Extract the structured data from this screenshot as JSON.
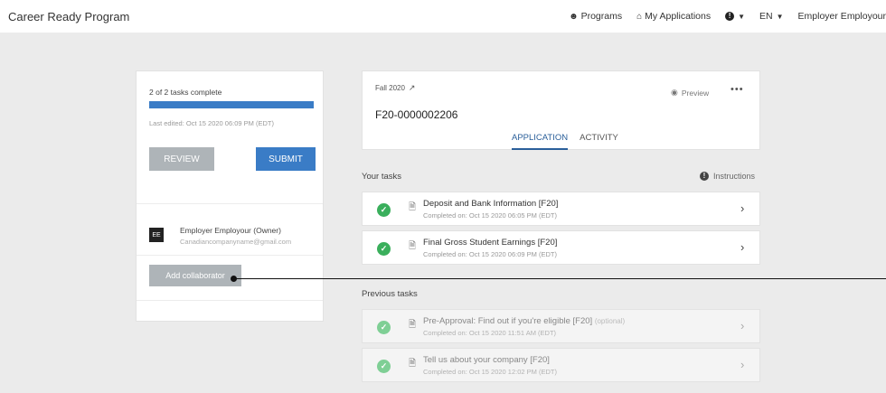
{
  "topbar": {
    "brand": "Career Ready Program",
    "nav": {
      "programs": "Programs",
      "my_applications": "My Applications",
      "language": "EN",
      "user": "Employer Employour"
    }
  },
  "summary": {
    "task_count": "2 of 2 tasks complete",
    "progress_fraction": 1.0,
    "last_edited": "Last edited: Oct 15 2020 06:09 PM (EDT)",
    "review_label": "REVIEW",
    "submit_label": "SUBMIT",
    "owner": {
      "initials": "EE",
      "name": "Employer Employour (Owner)",
      "email": "Canadiancompanyname@gmail.com"
    },
    "add_collaborator_label": "Add collaborator"
  },
  "application": {
    "term": "Fall 2020",
    "id": "F20-0000002206",
    "preview_label": "Preview",
    "more_label": "•••",
    "tabs": [
      {
        "label": "APPLICATION",
        "active": true
      },
      {
        "label": "ACTIVITY",
        "active": false
      }
    ]
  },
  "your_tasks": {
    "heading": "Your tasks",
    "instructions_label": "Instructions",
    "items": [
      {
        "title": "Deposit and Bank Information [F20]",
        "completed": "Completed on: Oct 15 2020 06:05 PM (EDT)"
      },
      {
        "title": "Final Gross Student Earnings [F20]",
        "completed": "Completed on: Oct 15 2020 06:09 PM (EDT)"
      }
    ]
  },
  "previous_tasks": {
    "heading": "Previous tasks",
    "items": [
      {
        "title": "Pre-Approval: Find out if you're eligible [F20]",
        "optional": "(optional)",
        "completed": "Completed on: Oct 15 2020 11:51 AM (EDT)"
      },
      {
        "title": "Tell us about your company [F20]",
        "optional": "",
        "completed": "Completed on: Oct 15 2020 12:02 PM (EDT)"
      }
    ]
  },
  "colors": {
    "primary": "#3a7cc6",
    "success": "#3aaf5c",
    "tab_active": "#2a5f9a"
  },
  "icons": {
    "programs": "people-icon",
    "my_applications": "home-icon",
    "help": "info-icon",
    "external": "external-link-icon",
    "preview": "eye-icon",
    "document": "document-icon",
    "check": "check-circle-icon",
    "chevron": "chevron-right-icon"
  }
}
